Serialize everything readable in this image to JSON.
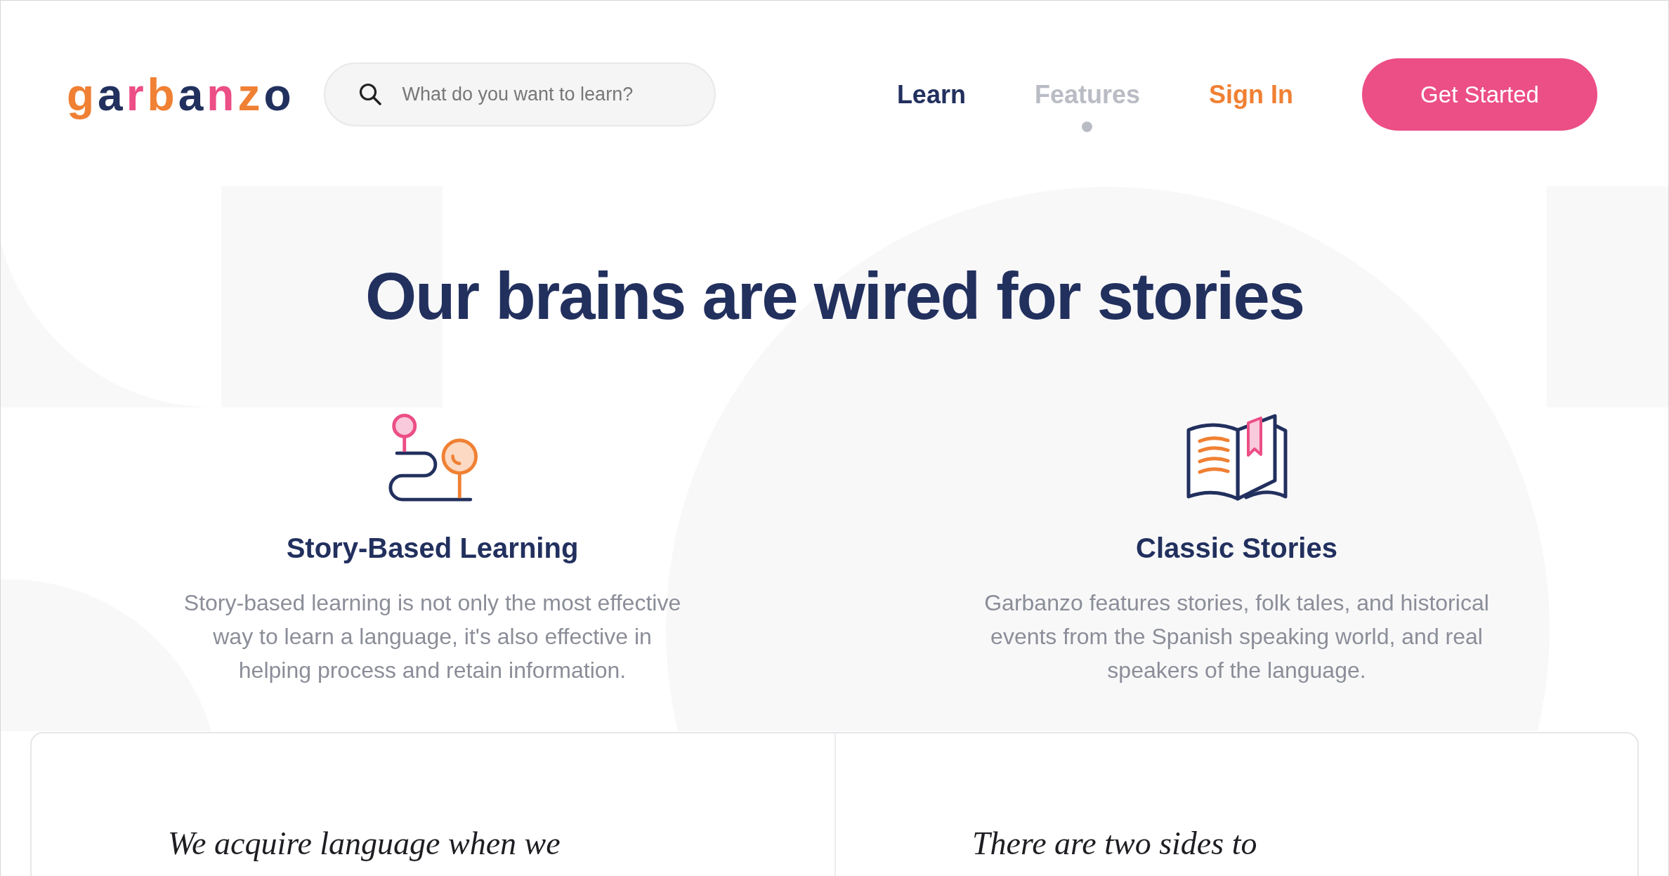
{
  "logo": {
    "text": "garbanzo"
  },
  "search": {
    "placeholder": "What do you want to learn?"
  },
  "nav": [
    {
      "label": "Learn",
      "selected": false
    },
    {
      "label": "Features",
      "selected": true
    }
  ],
  "sign_in_link": {
    "label": "Sign In"
  },
  "cta_button": {
    "label": "Get Started"
  },
  "headline": "Our brains are wired for stories",
  "features": [
    {
      "kind": "path",
      "title": "Story-Based Learning",
      "description": "Story-based learning is not only the most effective way to learn a language, it's also effective in helping process and retain information."
    },
    {
      "kind": "book",
      "title": "Classic Stories",
      "description": "Garbanzo features stories, folk tales, and historical events from the Spanish speaking world, and real speakers of the language."
    }
  ],
  "quotes": [
    {
      "text": "We acquire language when we"
    },
    {
      "text": "There are two sides to"
    }
  ]
}
